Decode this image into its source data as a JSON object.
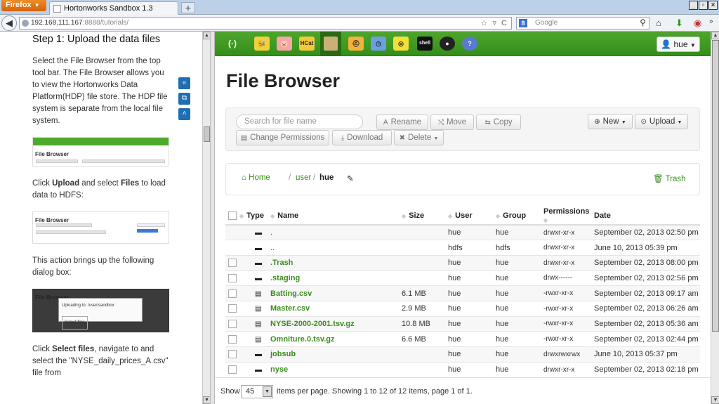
{
  "browser": {
    "menu_label": "Firefox",
    "tab_title": "Hortonworks Sandbox 1.3",
    "url_host": "192.168.111.167",
    "url_rest": ":8888/tutorials/",
    "search_placeholder": "Google"
  },
  "tutorial": {
    "heading": "Step 1: Upload the data files",
    "para1": "Select the File Browser from the top tool bar. The File Browser allows you to view the Hortonworks Data Platform(HDP) file store. The HDP file system is separate from the local file system.",
    "thumb1_title": "File Browser",
    "thumb2_title": "File Browser",
    "thumb3_title": "File Browser",
    "thumb3_dialog": "Uploading to: /user/sandbox",
    "thumb3_button": "Select files",
    "para2_pre": "Click ",
    "para2_b1": "Upload",
    "para2_mid": " and select ",
    "para2_b2": "Files",
    "para2_post": " to load data to HDFS:",
    "para3": "This action brings up the following dialog box:",
    "para4_pre": "Click ",
    "para4_b": "Select files",
    "para4_post": ", navigate to and select the \"NYSE_daily_prices_A.csv\" file from"
  },
  "app": {
    "user_menu": "hue",
    "page_title": "File Browser",
    "search_placeholder": "Search for file name",
    "actions": {
      "rename": "Rename",
      "move": "Move",
      "copy": "Copy",
      "new": "New",
      "upload": "Upload",
      "change_permissions": "Change Permissions",
      "download": "Download",
      "delete": "Delete"
    },
    "breadcrumb": {
      "home": "Home",
      "sep": "/",
      "user": "user",
      "current": "hue",
      "trash": "Trash"
    },
    "columns": {
      "type": "Type",
      "name": "Name",
      "size": "Size",
      "user": "User",
      "group": "Group",
      "permissions": "Permissions",
      "date": "Date"
    },
    "files": [
      {
        "type": "dir",
        "name": ".",
        "size": "",
        "user": "hue",
        "group": "hue",
        "perm": "drwxr-xr-x",
        "date": "September 02, 2013 02:50 pm",
        "link": false,
        "checkbox": false
      },
      {
        "type": "dir",
        "name": "..",
        "size": "",
        "user": "hdfs",
        "group": "hdfs",
        "perm": "drwxr-xr-x",
        "date": "June 10, 2013 05:39 pm",
        "link": false,
        "checkbox": false
      },
      {
        "type": "dir",
        "name": ".Trash",
        "size": "",
        "user": "hue",
        "group": "hue",
        "perm": "drwxr-xr-x",
        "date": "September 02, 2013 08:00 pm",
        "link": true,
        "checkbox": true
      },
      {
        "type": "dir",
        "name": ".staging",
        "size": "",
        "user": "hue",
        "group": "hue",
        "perm": "drwx------",
        "date": "September 02, 2013 02:56 pm",
        "link": true,
        "checkbox": true
      },
      {
        "type": "file",
        "name": "Batting.csv",
        "size": "6.1 MB",
        "user": "hue",
        "group": "hue",
        "perm": "-rwxr-xr-x",
        "date": "September 02, 2013 09:17 am",
        "link": true,
        "checkbox": true
      },
      {
        "type": "file",
        "name": "Master.csv",
        "size": "2.9 MB",
        "user": "hue",
        "group": "hue",
        "perm": "-rwxr-xr-x",
        "date": "September 02, 2013 06:26 am",
        "link": true,
        "checkbox": true
      },
      {
        "type": "file",
        "name": "NYSE-2000-2001.tsv.gz",
        "size": "10.8 MB",
        "user": "hue",
        "group": "hue",
        "perm": "-rwxr-xr-x",
        "date": "September 02, 2013 05:36 am",
        "link": true,
        "checkbox": true
      },
      {
        "type": "file",
        "name": "Omniture.0.tsv.gz",
        "size": "6.6 MB",
        "user": "hue",
        "group": "hue",
        "perm": "-rwxr-xr-x",
        "date": "September 02, 2013 02:44 pm",
        "link": true,
        "checkbox": true
      },
      {
        "type": "dir",
        "name": "jobsub",
        "size": "",
        "user": "hue",
        "group": "hue",
        "perm": "drwxrwxrwx",
        "date": "June 10, 2013 05:37 pm",
        "link": true,
        "checkbox": true
      },
      {
        "type": "dir",
        "name": "nyse",
        "size": "",
        "user": "hue",
        "group": "hue",
        "perm": "drwxr-xr-x",
        "date": "September 02, 2013 02:18 pm",
        "link": true,
        "checkbox": true
      }
    ],
    "footer": {
      "show": "Show",
      "page_size": "45",
      "summary": "items per page. Showing 1 to 12 of 12 items, page 1 of 1."
    },
    "hcat_label": "HCat",
    "shell_label": "shell"
  }
}
